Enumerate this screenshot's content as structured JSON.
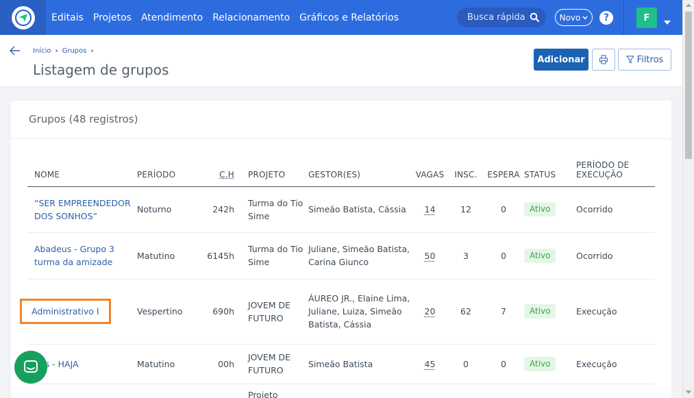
{
  "nav": {
    "items": [
      "Editais",
      "Projetos",
      "Atendimento",
      "Relacionamento",
      "Gráficos e Relatórios"
    ],
    "search_placeholder": "Busca rápida",
    "novo_label": "Novo",
    "help": "?",
    "avatar_initial": "F"
  },
  "breadcrumb": [
    "Início",
    "Grupos"
  ],
  "page_title": "Listagem de grupos",
  "actions": {
    "add_label": "Adicionar",
    "filter_label": "Filtros"
  },
  "card_title": "Grupos (48 registros)",
  "columns": {
    "nome": "NOME",
    "periodo": "PERÍODO",
    "ch": "C.H",
    "projeto": "PROJETO",
    "gestores": "GESTOR(ES)",
    "vagas": "VAGAS",
    "insc": "INSC.",
    "espera": "ESPERA",
    "status": "STATUS",
    "exec_line1": "PERÍODO DE",
    "exec_line2": "EXECUÇÃO"
  },
  "rows": [
    {
      "nome": "“SER EMPREENDEDOR DOS SONHOS”",
      "periodo": "Noturno",
      "ch": "242h",
      "projeto": "Turma do Tio Sime",
      "gestores": "Simeão Batista, Cássia",
      "vagas": "14",
      "insc": "12",
      "espera": "0",
      "status": "Ativo",
      "execucao": "Ocorrido"
    },
    {
      "nome": "Abadeus - Grupo 3 turma da amizade",
      "periodo": "Matutino",
      "ch": "6145h",
      "projeto": "Turma do Tio Sime",
      "gestores": "Juliane, Simeão Batista, Carina Giunco",
      "vagas": "50",
      "insc": "3",
      "espera": "0",
      "status": "Ativo",
      "execucao": "Ocorrido"
    },
    {
      "nome": "Administrativo I",
      "periodo": "Vespertino",
      "ch": "690h",
      "projeto": "JOVEM DE FUTURO",
      "gestores": "ÁUREO JR., Elaine Lima, Juliane, Luiza, Simeão Batista, Cássia",
      "vagas": "20",
      "insc": "62",
      "espera": "7",
      "status": "Ativo",
      "execucao": "Execução"
    },
    {
      "nome": "es - HAJA",
      "periodo": "Matutino",
      "ch": "00h",
      "projeto": "JOVEM DE FUTURO",
      "gestores": "Simeão Batista",
      "vagas": "45",
      "insc": "0",
      "espera": "0",
      "status": "Ativo",
      "execucao": "Execução"
    },
    {
      "nome": "",
      "periodo": "",
      "ch": "",
      "projeto": "Projeto",
      "gestores": "",
      "vagas": "",
      "insc": "",
      "espera": "",
      "status": "",
      "execucao": ""
    }
  ],
  "colors": {
    "nav_bg": "#2d6cdf",
    "primary": "#1b62b3",
    "status_active_bg": "#e4f6e6",
    "status_active_fg": "#3aa649",
    "highlight": "#f08427",
    "chat": "#17a05d"
  }
}
